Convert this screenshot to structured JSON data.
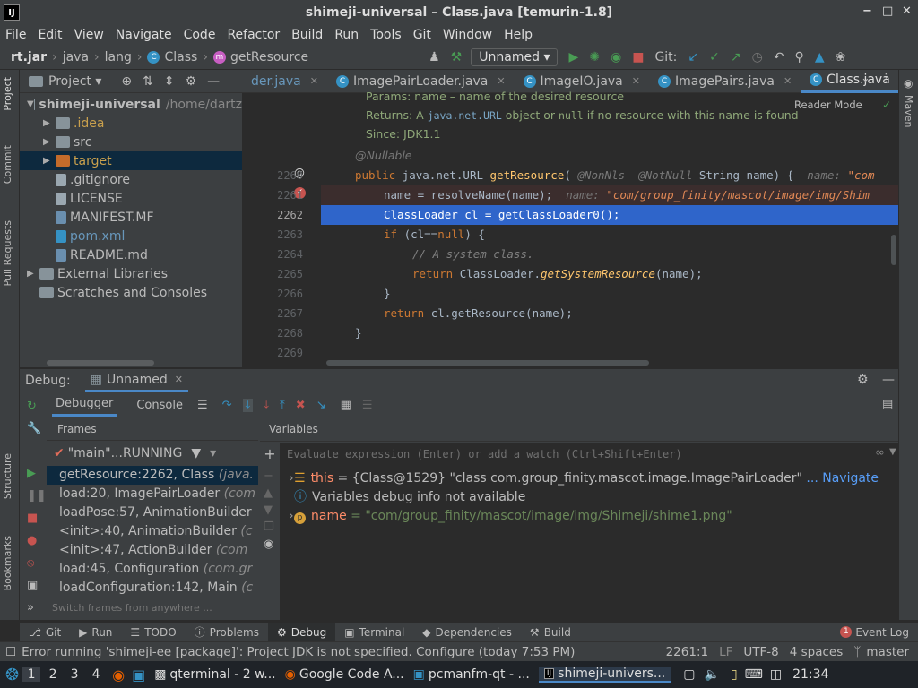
{
  "window": {
    "title": "shimeji-universal – Class.java [temurin-1.8]",
    "logo": "IJ",
    "ctrl_min": "−",
    "ctrl_restore": "□",
    "ctrl_close": "✕"
  },
  "menu": [
    "File",
    "Edit",
    "View",
    "Navigate",
    "Code",
    "Refactor",
    "Build",
    "Run",
    "Tools",
    "Git",
    "Window",
    "Help"
  ],
  "nav": {
    "crumbs": [
      "rt.jar",
      "java",
      "lang",
      "Class",
      "getResource"
    ],
    "run_config": "Unnamed",
    "git_label": "Git:",
    "run_config_arrow": "▾"
  },
  "left_strip": [
    "Project",
    "Commit",
    "Pull Requests",
    "Structure",
    "Bookmarks"
  ],
  "right_strip": [
    "Maven"
  ],
  "project": {
    "header": "Project",
    "header_arrow": "▾",
    "tree": [
      {
        "label": "shimeji-universal",
        "note": "/home/dartz",
        "arrow": "▼",
        "indent": 0,
        "icon": "folder",
        "color": "#87939a",
        "bold": true
      },
      {
        "label": ".idea",
        "arrow": "▶",
        "indent": 1,
        "icon": "folder",
        "color": "#87939a",
        "text": "#c9a04d"
      },
      {
        "label": "src",
        "arrow": "▶",
        "indent": 1,
        "icon": "folder",
        "color": "#87939a"
      },
      {
        "label": "target",
        "arrow": "▶",
        "indent": 1,
        "icon": "folder",
        "color": "#c36b2b",
        "text": "#c9a04d",
        "sel": true
      },
      {
        "label": ".gitignore",
        "arrow": "",
        "indent": 1,
        "icon": "file",
        "color": "#9aa7b0"
      },
      {
        "label": "LICENSE",
        "arrow": "",
        "indent": 1,
        "icon": "file",
        "color": "#9aa7b0"
      },
      {
        "label": "MANIFEST.MF",
        "arrow": "",
        "indent": 1,
        "icon": "file",
        "color": "#6a8faf"
      },
      {
        "label": "pom.xml",
        "arrow": "",
        "indent": 1,
        "icon": "file",
        "color": "#3592c4",
        "text": "#6897bb"
      },
      {
        "label": "README.md",
        "arrow": "",
        "indent": 1,
        "icon": "file",
        "color": "#6a8faf"
      },
      {
        "label": "External Libraries",
        "arrow": "▶",
        "indent": 0,
        "icon": "lib",
        "color": "#87939a"
      },
      {
        "label": "Scratches and Consoles",
        "arrow": "",
        "indent": 0,
        "icon": "scratch",
        "color": "#87939a"
      }
    ]
  },
  "editor": {
    "tabs": [
      {
        "label": "der.java",
        "icon": false
      },
      {
        "label": "ImagePairLoader.java",
        "icon": true
      },
      {
        "label": "ImageIO.java",
        "icon": true
      },
      {
        "label": "ImagePairs.java",
        "icon": true
      },
      {
        "label": "Class.java",
        "icon": true,
        "active": true
      }
    ],
    "tab_close": "✕",
    "class_icon_letter": "C",
    "reader_mode": "Reader Mode",
    "doc_params": "Params: name – name of the desired resource",
    "doc_returns_pre": "Returns: A ",
    "doc_returns_code": "java.net.URL",
    "doc_returns_mid": " object or ",
    "doc_returns_null": "null",
    "doc_returns_post": " if no resource with this name is found",
    "doc_since": "Since:     JDK1.1",
    "nullable": "@Nullable",
    "lines": [
      "2260",
      "2261",
      "2262",
      "2263",
      "2264",
      "2265",
      "2266",
      "2267",
      "2268",
      "2269"
    ],
    "code": {
      "l2260_kw": "public ",
      "l2260_a": "java.net.URL ",
      "l2260_m": "getResource",
      "l2260_b": "( ",
      "l2260_h1": "@NonNls ",
      "l2260_h2": " @NotNull ",
      "l2260_c": "String name) { ",
      "l2260_hint": " name: ",
      "l2260_hs": "\"com",
      "l2261_a": "name = resolveName(name);",
      "l2261_hint": "  name: ",
      "l2261_hs": "\"com/group_finity/mascot/image/img/Shim",
      "l2262": "ClassLoader cl = getClassLoader0();",
      "l2263_kw": "if ",
      "l2263_a": "(cl==",
      "l2263_kw2": "null",
      "l2263_b": ") {",
      "l2264": "// A system class.",
      "l2265_kw": "return ",
      "l2265_a": "ClassLoader.",
      "l2265_m": "getSystemResource",
      "l2265_b": "(name);",
      "l2266": "}",
      "l2267_kw": "return ",
      "l2267_a": "cl.getResource(name);",
      "l2268": "}"
    }
  },
  "debug": {
    "label": "Debug:",
    "config": "Unnamed",
    "tab_debugger": "Debugger",
    "tab_console": "Console",
    "frames_header": "Frames",
    "variables_header": "Variables",
    "thread": "\"main\"...RUNNING",
    "frames": [
      {
        "m": "getResource:2262, Class ",
        "p": "(java.",
        "sel": true
      },
      {
        "m": "load:20, ImagePairLoader ",
        "p": "(com"
      },
      {
        "m": "loadPose:57, AnimationBuilder",
        "p": ""
      },
      {
        "m": "<init>:40, AnimationBuilder ",
        "p": "(c"
      },
      {
        "m": "<init>:47, ActionBuilder ",
        "p": "(com"
      },
      {
        "m": "load:45, Configuration ",
        "p": "(com.gr"
      },
      {
        "m": "loadConfiguration:142, Main ",
        "p": "(c"
      }
    ],
    "switch_frames": "Switch frames from anywhere ...",
    "eval_placeholder": "Evaluate expression (Enter) or add a watch (Ctrl+Shift+Enter)",
    "glasses": "∞",
    "vars": {
      "this_name": "this",
      "this_val": " = {Class@1529} \"class com.group_finity.mascot.image.ImagePairLoader\"",
      "navigate": " ... Navigate",
      "info": "Variables debug info not available",
      "name_name": "name",
      "name_val": " = \"com/group_finity/mascot/image/img/Shimeji/shime1.png\""
    }
  },
  "bottom_tabs": [
    {
      "label": "Git",
      "icon": "⎇"
    },
    {
      "label": "Run",
      "icon": "▶"
    },
    {
      "label": "TODO",
      "icon": "☰"
    },
    {
      "label": "Problems",
      "icon": "ⓘ"
    },
    {
      "label": "Debug",
      "icon": "⚙",
      "active": true
    },
    {
      "label": "Terminal",
      "icon": "▣"
    },
    {
      "label": "Dependencies",
      "icon": "◆"
    },
    {
      "label": "Build",
      "icon": "⚒"
    }
  ],
  "event_log": "Event Log",
  "event_count": "1",
  "status": {
    "message": "Error running 'shimeji-ee [package]': Project JDK is not specified. Configure (today 7:53 PM)",
    "pos": "2261:1",
    "lf": "LF",
    "enc": "UTF-8",
    "indent": "4 spaces",
    "branch": "master"
  },
  "taskbar": {
    "workspaces": [
      "1",
      "2",
      "3",
      "4"
    ],
    "tasks": [
      "qterminal - 2 w...",
      "Google Code A...",
      "pcmanfm-qt - ...",
      "shimeji-univers..."
    ],
    "clock": "21:34"
  },
  "colors": {
    "accent": "#4a88c7",
    "selection": "#2f65ca",
    "breakpoint": "#c75450",
    "run": "#499c54"
  }
}
